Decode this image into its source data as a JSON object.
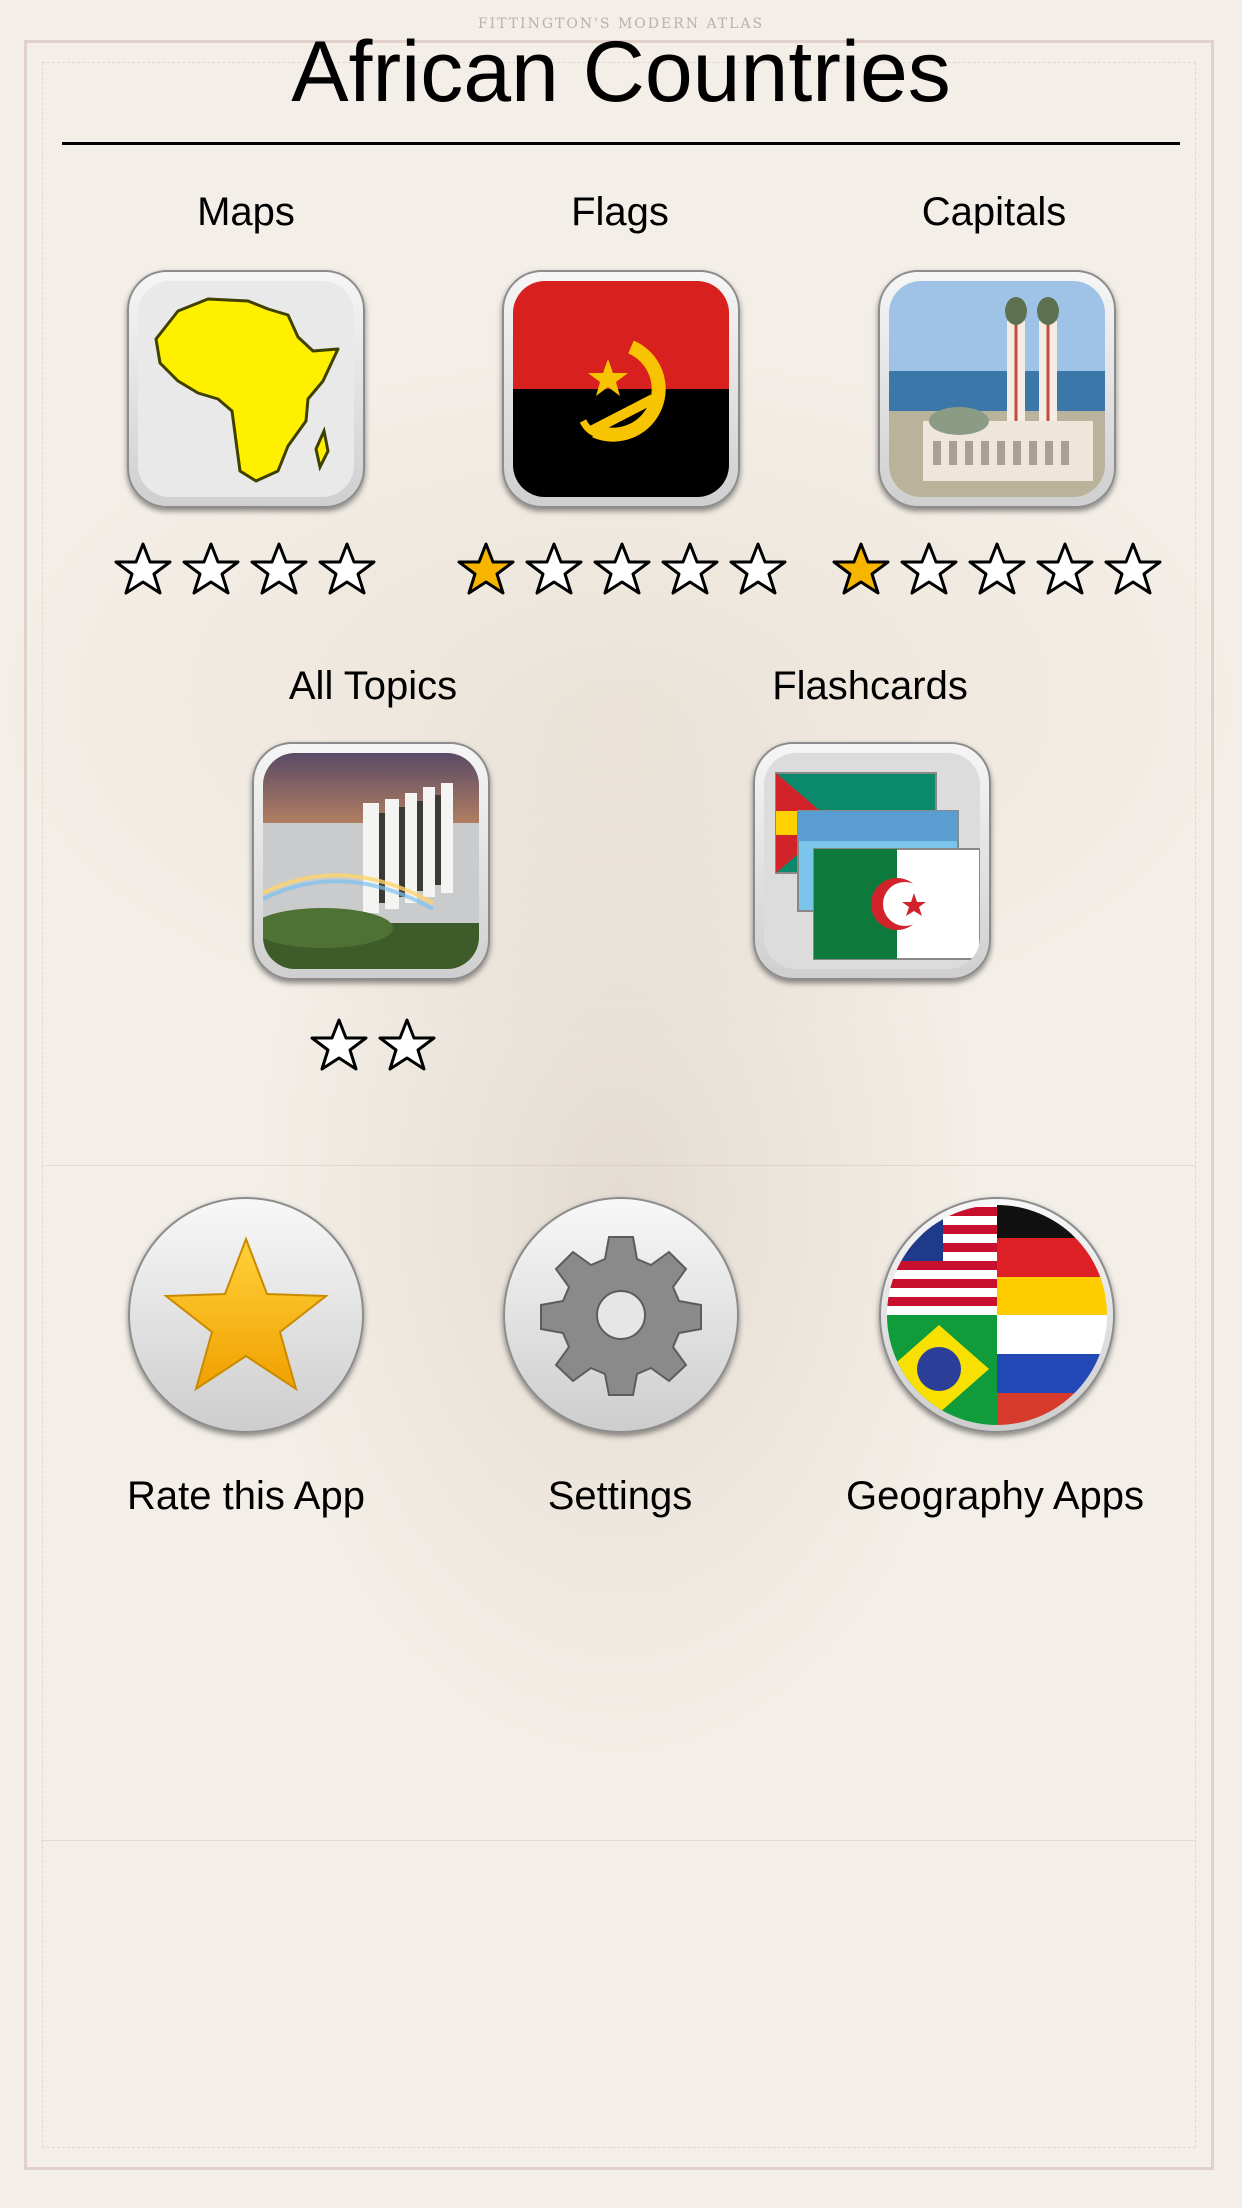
{
  "app": {
    "title": "African Countries",
    "atlas_caption": "FITTINGTON'S MODERN ATLAS"
  },
  "topics": [
    {
      "label": "Maps",
      "stars_earned": 0,
      "stars_total": 4,
      "icon": "africa-map-icon"
    },
    {
      "label": "Flags",
      "stars_earned": 1,
      "stars_total": 5,
      "icon": "angola-flag-icon"
    },
    {
      "label": "Capitals",
      "stars_earned": 1,
      "stars_total": 5,
      "icon": "mosque-photo-icon"
    },
    {
      "label": "All Topics",
      "stars_earned": 0,
      "stars_total": 2,
      "icon": "waterfall-photo-icon"
    },
    {
      "label": "Flashcards",
      "icon": "flashcards-flags-icon"
    }
  ],
  "actions": [
    {
      "label": "Rate this App",
      "icon": "star-icon"
    },
    {
      "label": "Settings",
      "icon": "gear-icon"
    },
    {
      "label": "Geography Apps",
      "icon": "world-flags-icon"
    }
  ],
  "colors": {
    "star_gold": "#f7b500",
    "map_yellow": "#fff000",
    "angola_red": "#d8211e",
    "algeria_green": "#0d7a3c"
  }
}
